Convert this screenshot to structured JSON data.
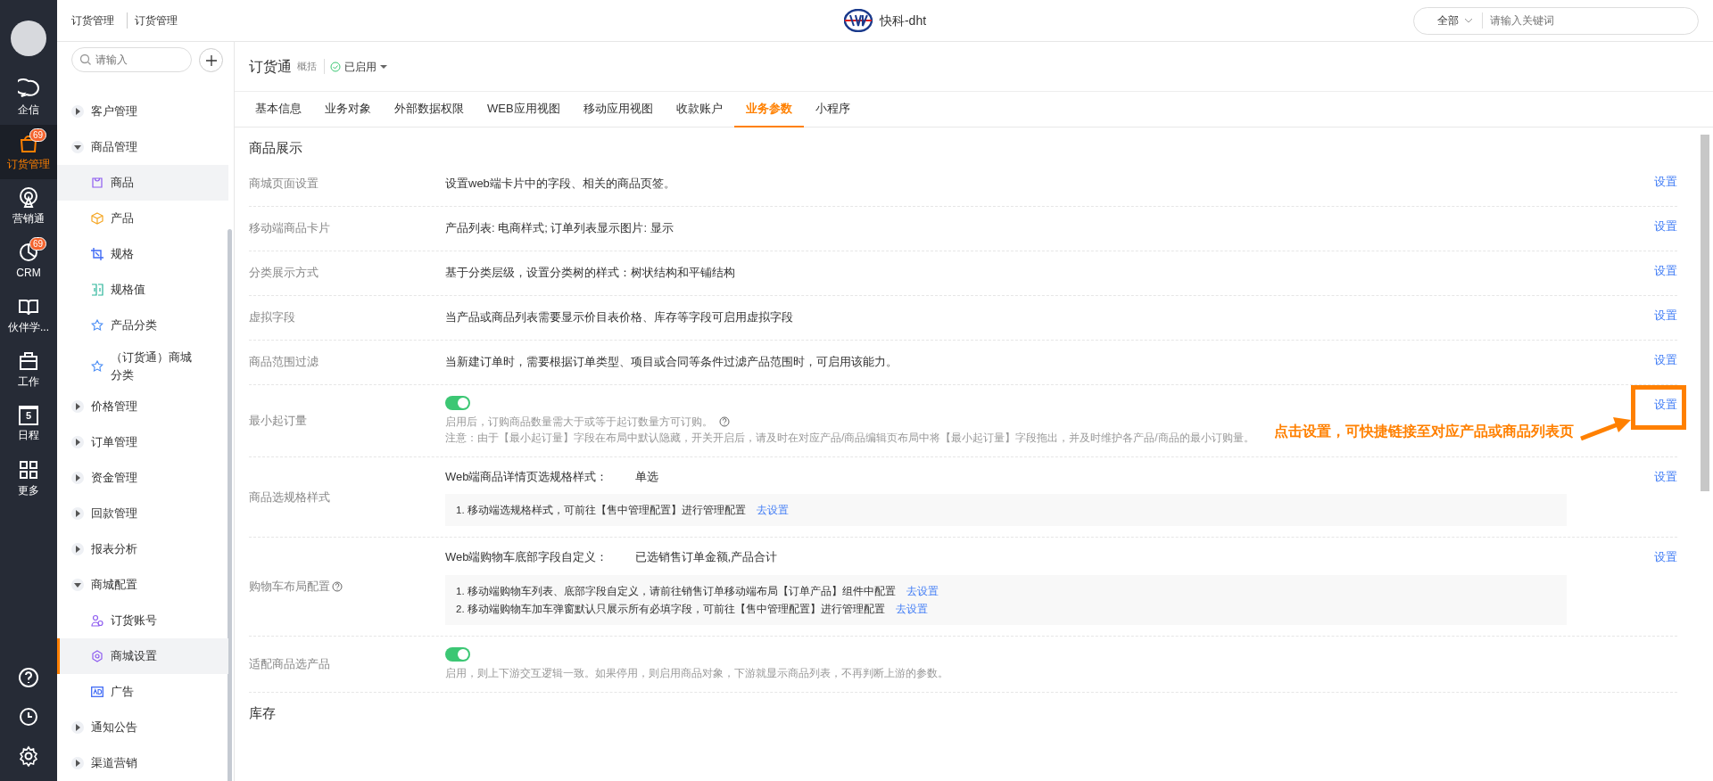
{
  "rail": {
    "items": [
      {
        "label": "企信",
        "selected": false
      },
      {
        "label": "订货管理",
        "selected": true,
        "badge": "69"
      },
      {
        "label": "营销通",
        "selected": false
      },
      {
        "label": "CRM",
        "selected": false,
        "badge": "69"
      },
      {
        "label": "伙伴学...",
        "selected": false
      },
      {
        "label": "工作",
        "selected": false
      },
      {
        "label": "日程",
        "selected": false,
        "day": "5"
      },
      {
        "label": "更多",
        "selected": false
      }
    ]
  },
  "header": {
    "breadcrumb": [
      "订货管理",
      "订货管理"
    ],
    "brand": "快科-dht",
    "search": {
      "scope": "全部",
      "placeholder": "请输入关键词"
    }
  },
  "sidebar": {
    "search_placeholder": "请输入",
    "items": [
      {
        "label": "客户管理",
        "expanded": false
      },
      {
        "label": "商品管理",
        "expanded": true,
        "children": [
          {
            "label": "商品",
            "selected": false,
            "hovered": true
          },
          {
            "label": "产品",
            "selected": false,
            "hovered": false
          },
          {
            "label": "规格",
            "selected": false,
            "hovered": false
          },
          {
            "label": "规格值",
            "selected": false,
            "hovered": false
          },
          {
            "label": "产品分类",
            "selected": false,
            "hovered": false
          },
          {
            "label": "（订货通）商城分类",
            "selected": false,
            "hovered": false
          }
        ]
      },
      {
        "label": "价格管理",
        "expanded": false
      },
      {
        "label": "订单管理",
        "expanded": false
      },
      {
        "label": "资金管理",
        "expanded": false
      },
      {
        "label": "回款管理",
        "expanded": false
      },
      {
        "label": "报表分析",
        "expanded": false
      },
      {
        "label": "商城配置",
        "expanded": true,
        "children": [
          {
            "label": "订货账号",
            "selected": false,
            "hovered": false
          },
          {
            "label": "商城设置",
            "selected": true,
            "hovered": false
          },
          {
            "label": "广告",
            "selected": false,
            "hovered": false
          }
        ]
      },
      {
        "label": "通知公告",
        "expanded": false
      },
      {
        "label": "渠道营销",
        "expanded": false
      }
    ]
  },
  "app": {
    "title": "订货通",
    "summary": "概括",
    "status": "已启用"
  },
  "tabs": [
    {
      "label": "基本信息",
      "selected": false
    },
    {
      "label": "业务对象",
      "selected": false
    },
    {
      "label": "外部数据权限",
      "selected": false
    },
    {
      "label": "WEB应用视图",
      "selected": false
    },
    {
      "label": "移动应用视图",
      "selected": false
    },
    {
      "label": "收款账户",
      "selected": false
    },
    {
      "label": "业务参数",
      "selected": true
    },
    {
      "label": "小程序",
      "selected": false
    }
  ],
  "sections": [
    {
      "title": "商品展示",
      "rows": [
        {
          "kind": "text",
          "label": "商城页面设置",
          "description": "设置web端卡片中的字段、相关的商品页签。",
          "link": "设置"
        },
        {
          "kind": "text",
          "label": "移动端商品卡片",
          "description": "产品列表: 电商样式; 订单列表显示图片: 显示",
          "link": "设置"
        },
        {
          "kind": "text",
          "label": "分类展示方式",
          "description": "基于分类层级，设置分类树的样式：树状结构和平铺结构",
          "link": "设置"
        },
        {
          "kind": "text",
          "label": "虚拟字段",
          "description": "当产品或商品列表需要显示价目表价格、库存等字段可启用虚拟字段",
          "link": "设置"
        },
        {
          "kind": "text",
          "label": "商品范围过滤",
          "description": "当新建订单时，需要根据订单类型、项目或合同等条件过滤产品范围时，可启用该能力。",
          "link": "设置"
        },
        {
          "kind": "toggle",
          "label": "最小起订量",
          "on": true,
          "hint": "启用后，订购商品数量需大于或等于起订数量方可订购。",
          "hint_help": true,
          "note": "注意：由于【最小起订量】字段在布局中默认隐藏，开关开启后，请及时在对应产品/商品编辑页布局中将【最小起订量】字段拖出，并及时维护各产品/商品的最小订购量。",
          "link": "设置",
          "annotation": "点击设置，可快捷链接至对应产品或商品列表页"
        },
        {
          "kind": "field",
          "label": "商品选规格样式",
          "label_help": false,
          "field": "Web端商品详情页选规格样式：",
          "value": "单选",
          "link": "设置",
          "notes": [
            {
              "text": "1. 移动端选规格样式，可前往【售中管理配置】进行管理配置",
              "link": "去设置"
            }
          ]
        },
        {
          "kind": "field",
          "label": "购物车布局配置",
          "label_help": true,
          "field": "Web端购物车底部字段自定义：",
          "value": "已选销售订单金额,产品合计",
          "link": "设置",
          "notes": [
            {
              "text": "1. 移动端购物车列表、底部字段自定义，请前往销售订单移动端布局【订单产品】组件中配置",
              "link": "去设置"
            },
            {
              "text": "2. 移动端购物车加车弹窗默认只展示所有必填字段，可前往【售中管理配置】进行管理配置",
              "link": "去设置"
            }
          ]
        },
        {
          "kind": "toggle",
          "label": "适配商品选产品",
          "on": true,
          "hint": "启用，则上下游交互逻辑一致。如果停用，则启用商品对象，下游就显示商品列表，不再判断上游的参数。",
          "hint_help": false
        }
      ]
    },
    {
      "title": "库存"
    }
  ]
}
